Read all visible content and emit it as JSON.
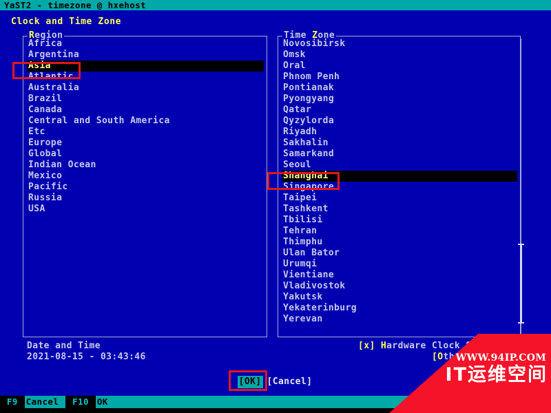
{
  "window": {
    "title": "YaST2 - timezone @ hxehost",
    "title_bg": "#00a8a8",
    "screen_bg": "#0000b0"
  },
  "dialog": {
    "heading": "Clock and Time Zone"
  },
  "region_panel": {
    "frame_label": "Region",
    "frame_label_hotkey": "R",
    "frame_label_rest": "egion",
    "selected": "Asia",
    "items": [
      "Africa",
      "Argentina",
      "Asia",
      "Atlantic",
      "Australia",
      "Brazil",
      "Canada",
      "Central and South America",
      "Etc",
      "Europe",
      "Global",
      "Indian Ocean",
      "Mexico",
      "Pacific",
      "Russia",
      "USA"
    ]
  },
  "timezone_panel": {
    "frame_label": "Time Zone",
    "frame_label_pre": "Time ",
    "frame_label_hotkey": "Z",
    "frame_label_rest": "one",
    "selected": "Shanghai",
    "items": [
      "Novosibirsk",
      "Omsk",
      "Oral",
      "Phnom Penh",
      "Pontianak",
      "Pyongyang",
      "Qatar",
      "Qyzylorda",
      "Riyadh",
      "Sakhalin",
      "Samarkand",
      "Seoul",
      "Shanghai",
      "Singapore",
      "Taipei",
      "Tashkent",
      "Tbilisi",
      "Tehran",
      "Thimphu",
      "Ulan Bator",
      "Urumqi",
      "Vientiane",
      "Vladivostok",
      "Yakutsk",
      "Yekaterinburg",
      "Yerevan"
    ],
    "scrollbar": "vertical-scrollbar"
  },
  "footer": {
    "date_time_label": "Date and Time",
    "date_time_value": "2021-08-15 - 03:43:46",
    "hardware_clock_checkbox": "[x]",
    "hardware_clock_hotkey": "H",
    "hardware_clock_pre": "",
    "hardware_clock_rest": "ardware Clock Set to UTC",
    "other_settings_bracket": "[",
    "other_settings_hotkey": "O",
    "other_settings_rest": "ther Settings"
  },
  "buttons": {
    "ok": "[OK]",
    "cancel": "[Cancel]"
  },
  "function_bar": {
    "keys": [
      {
        "key": "F9",
        "label": "Cancel"
      },
      {
        "key": "F10",
        "label": "OK"
      }
    ]
  },
  "watermark": {
    "url": "WWW.94IP.COM",
    "text": "IT运维空间",
    "color": "#f51329"
  },
  "annotations": [
    {
      "name": "asia-highlight",
      "target": "Asia",
      "color": "#e01818"
    },
    {
      "name": "shanghai-highlight",
      "target": "Shanghai",
      "color": "#e01818"
    },
    {
      "name": "ok-highlight",
      "target": "[OK]",
      "color": "#e01818"
    }
  ]
}
